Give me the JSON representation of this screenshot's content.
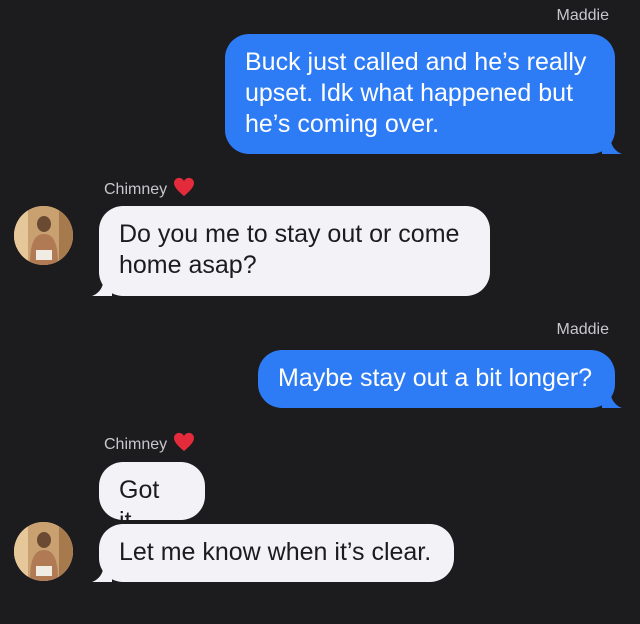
{
  "colors": {
    "background": "#1c1c1e",
    "sent_bubble": "#2e7bf6",
    "received_bubble": "#f2f2f7",
    "sender_text": "#c7c7cc",
    "heart": "#e32b3b"
  },
  "messages": [
    {
      "sender": "Maddie",
      "text": "Buck just called and he’s really upset. Idk what happened but he’s coming over.",
      "side": "right"
    },
    {
      "sender": "Chimney",
      "text": "Do you me to stay out or come home asap?",
      "side": "left",
      "reaction_icon": "heart-icon"
    },
    {
      "sender": "Maddie",
      "text": "Maybe stay out a bit longer?",
      "side": "right"
    },
    {
      "sender": "Chimney",
      "text": "Got it.",
      "side": "left",
      "reaction_icon": "heart-icon"
    },
    {
      "sender": "Chimney",
      "text": "Let me know when it’s clear.",
      "side": "left"
    }
  ]
}
